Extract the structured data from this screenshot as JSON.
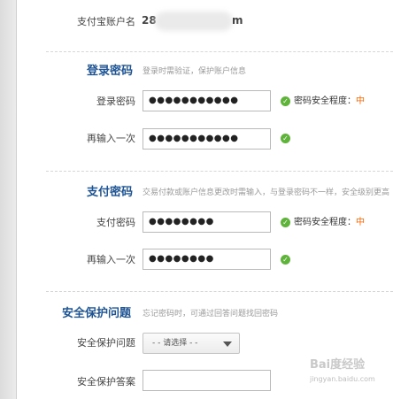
{
  "account": {
    "label": "支付宝账户名",
    "value_prefix": "28",
    "value_suffix": "m"
  },
  "login_password": {
    "title": "登录密码",
    "hint": "登录时需验证，保护账户信息",
    "field_label": "登录密码",
    "field_value": "●●●●●●●●●●●",
    "confirm_label": "再输入一次",
    "confirm_value": "●●●●●●●●●●●",
    "strength_label": "密码安全程度：",
    "strength_level": "中"
  },
  "pay_password": {
    "title": "支付密码",
    "hint": "交易付款或账户信息更改时需输入，与登录密码不一样，安全级别更高",
    "field_label": "支付密码",
    "field_value": "●●●●●●●●",
    "confirm_label": "再输入一次",
    "confirm_value": "●●●●●●●●",
    "strength_label": "密码安全程度：",
    "strength_level": "中"
  },
  "security_question": {
    "title": "安全保护问题",
    "hint": "忘记密码时，可通过回答问题找回密码",
    "question_label": "安全保护问题",
    "question_select": "- - 请选择 - -",
    "answer_label": "安全保护答案",
    "answer_value": ""
  },
  "watermark": {
    "text": "Bai度经验",
    "sub": "jingyan.baidu.com"
  },
  "colors": {
    "section_title": "#1e5494",
    "strength_level": "#ff6600",
    "check": "#5fb33a"
  }
}
